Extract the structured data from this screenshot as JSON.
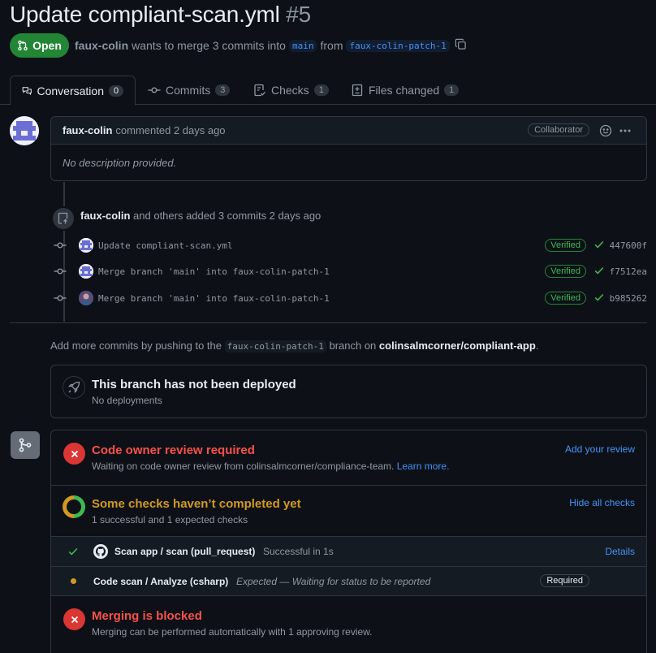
{
  "pr": {
    "title": "Update compliant-scan.yml",
    "number": "#5",
    "state": "Open",
    "author": "faux-colin",
    "merge_text": "wants to merge 3 commits into",
    "base_branch": "main",
    "from_text": "from",
    "head_branch": "faux-colin-patch-1"
  },
  "tabs": [
    {
      "label": "Conversation",
      "count": "0"
    },
    {
      "label": "Commits",
      "count": "3"
    },
    {
      "label": "Checks",
      "count": "1"
    },
    {
      "label": "Files changed",
      "count": "1"
    }
  ],
  "comment": {
    "author": "faux-colin",
    "action": "commented 2 days ago",
    "role": "Collaborator",
    "body": "No description provided."
  },
  "commits_summary": {
    "author": "faux-colin",
    "text": "and others added 3 commits 2 days ago"
  },
  "commits": [
    {
      "message": "Update compliant-scan.yml",
      "verified": "Verified",
      "sha": "447600f"
    },
    {
      "message": "Merge branch 'main' into faux-colin-patch-1",
      "verified": "Verified",
      "sha": "f7512ea"
    },
    {
      "message": "Merge branch 'main' into faux-colin-patch-1",
      "verified": "Verified",
      "sha": "b985262"
    }
  ],
  "push_note": {
    "prefix": "Add more commits by pushing to the",
    "branch": "faux-colin-patch-1",
    "middle": "branch on",
    "repo": "colinsalmcorner/compliant-app",
    "suffix": "."
  },
  "deployment": {
    "title": "This branch has not been deployed",
    "subtitle": "No deployments"
  },
  "merge_box": {
    "review": {
      "title": "Code owner review required",
      "subtitle": "Waiting on code owner review from colinsalmcorner/compliance-team.",
      "learn_more": "Learn more.",
      "action": "Add your review"
    },
    "checks": {
      "title": "Some checks haven’t completed yet",
      "subtitle": "1 successful and 1 expected checks",
      "action": "Hide all checks",
      "items": [
        {
          "name": "Scan app / scan (pull_request)",
          "status": "Successful in 1s",
          "action": "Details"
        },
        {
          "name": "Code scan / Analyze (csharp)",
          "status": "Expected — Waiting for status to be reported",
          "badge": "Required"
        }
      ]
    },
    "blocked": {
      "title": "Merging is blocked",
      "subtitle": "Merging can be performed automatically with 1 approving review."
    }
  },
  "colors": {
    "background": "#0d1117",
    "accent_blue": "#4493f8",
    "success_green": "#238636",
    "danger_red": "#f85149",
    "attention_amber": "#d29922",
    "border": "#30363d"
  }
}
